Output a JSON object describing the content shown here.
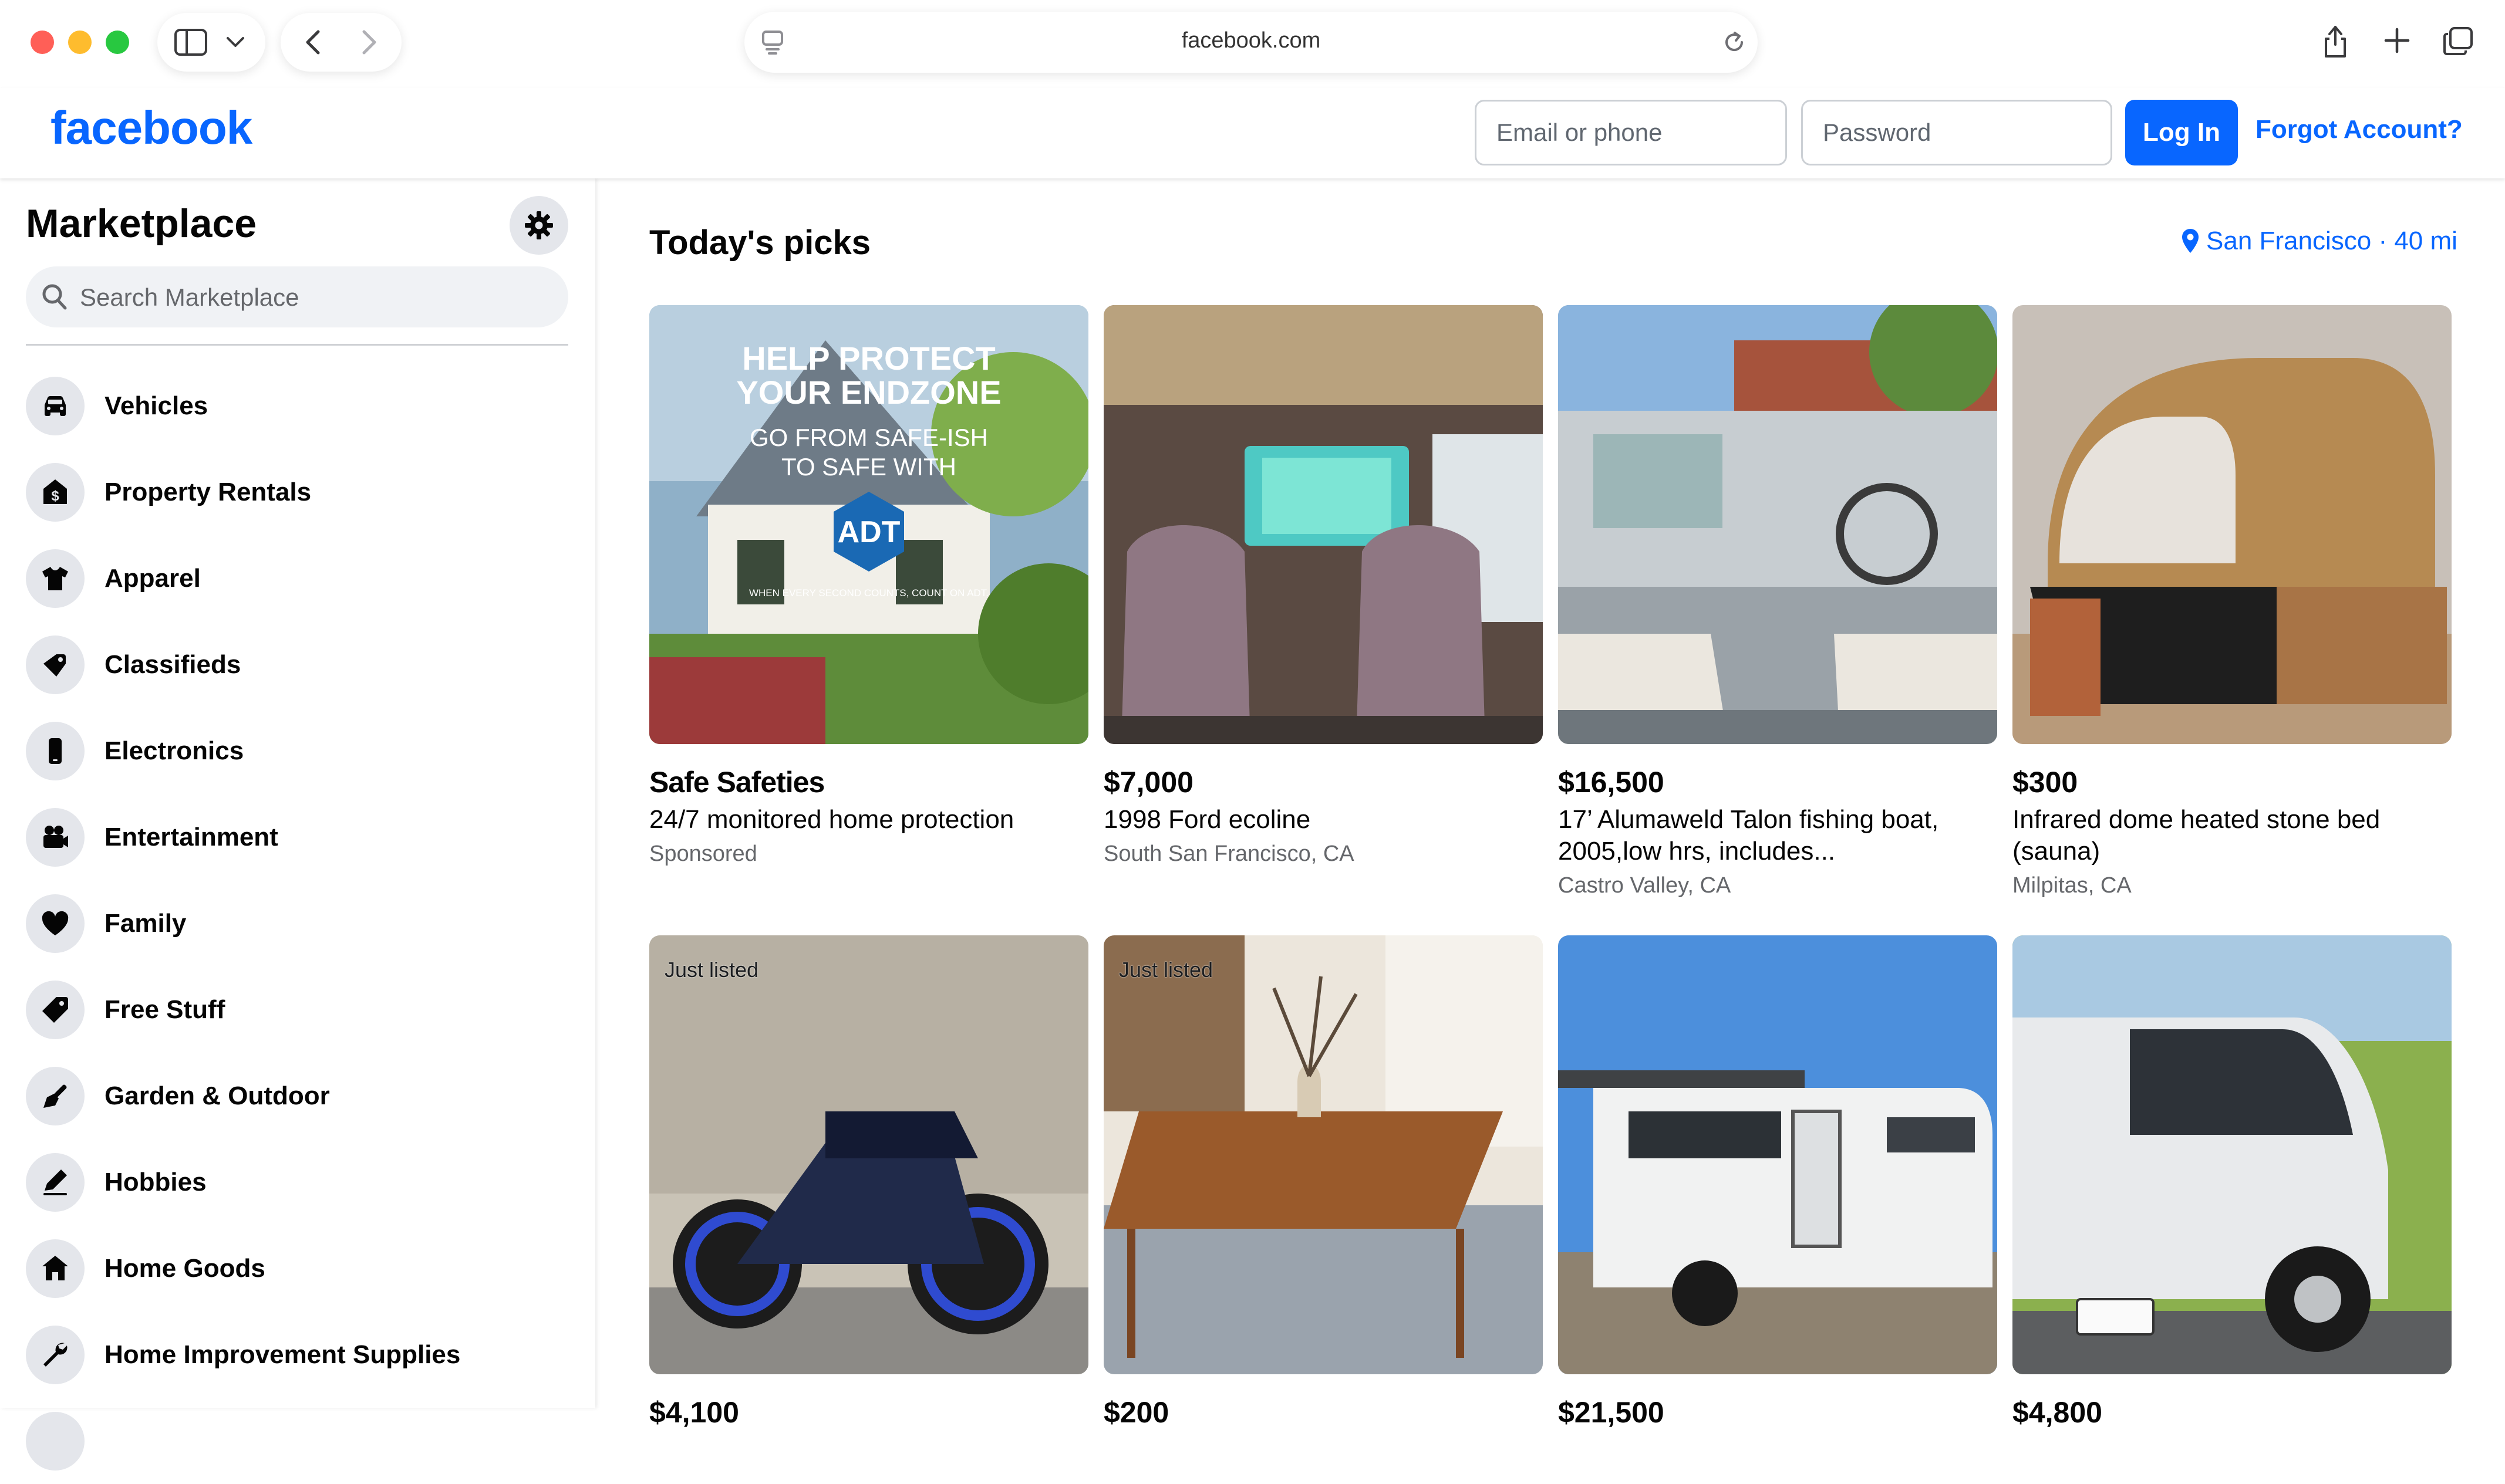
{
  "browser": {
    "url": "facebook.com"
  },
  "header": {
    "logo": "facebook",
    "email_placeholder": "Email or phone",
    "password_placeholder": "Password",
    "login_label": "Log In",
    "forgot_label": "Forgot Account?"
  },
  "sidebar": {
    "title": "Marketplace",
    "search_placeholder": "Search Marketplace",
    "items": [
      {
        "label": "Vehicles",
        "icon": "car-icon"
      },
      {
        "label": "Property Rentals",
        "icon": "house-dollar-icon"
      },
      {
        "label": "Apparel",
        "icon": "shirt-icon"
      },
      {
        "label": "Classifieds",
        "icon": "megaphone-tag-icon"
      },
      {
        "label": "Electronics",
        "icon": "phone-icon"
      },
      {
        "label": "Entertainment",
        "icon": "film-camera-icon"
      },
      {
        "label": "Family",
        "icon": "heart-icon"
      },
      {
        "label": "Free Stuff",
        "icon": "tag-icon"
      },
      {
        "label": "Garden & Outdoor",
        "icon": "trowel-icon"
      },
      {
        "label": "Hobbies",
        "icon": "pen-icon"
      },
      {
        "label": "Home Goods",
        "icon": "home-icon"
      },
      {
        "label": "Home Improvement Supplies",
        "icon": "wrench-icon"
      }
    ]
  },
  "main": {
    "title": "Today's picks",
    "location": "San Francisco · 40 mi",
    "listings": [
      {
        "price": "Safe Safeties",
        "title": "24/7 monitored home protection",
        "location": "Sponsored",
        "sponsored": true,
        "ad_text": {
          "line1": "HELP PROTECT",
          "line2": "YOUR ENDZONE",
          "line3": "GO FROM SAFE-ISH",
          "line4": "TO SAFE WITH",
          "brand": "ADT",
          "tagline": "WHEN EVERY SECOND COUNTS, COUNT ON ADT."
        }
      },
      {
        "price": "$7,000",
        "title": "1998 Ford ecoline",
        "location": "South San Francisco, CA"
      },
      {
        "price": "$16,500",
        "title": "17’ Alumaweld Talon fishing boat, 2005,low hrs, includes...",
        "location": "Castro Valley, CA"
      },
      {
        "price": "$300",
        "title": "Infrared dome heated stone bed (sauna)",
        "location": "Milpitas, CA"
      },
      {
        "price": "$4,100",
        "badge": "Just listed"
      },
      {
        "price": "$200",
        "badge": "Just listed"
      },
      {
        "price": "$21,500"
      },
      {
        "price": "$4,800"
      }
    ]
  },
  "colors": {
    "brand": "#0866ff",
    "sidebar_icon_bg": "#e4e6eb",
    "muted_text": "#65676b"
  }
}
